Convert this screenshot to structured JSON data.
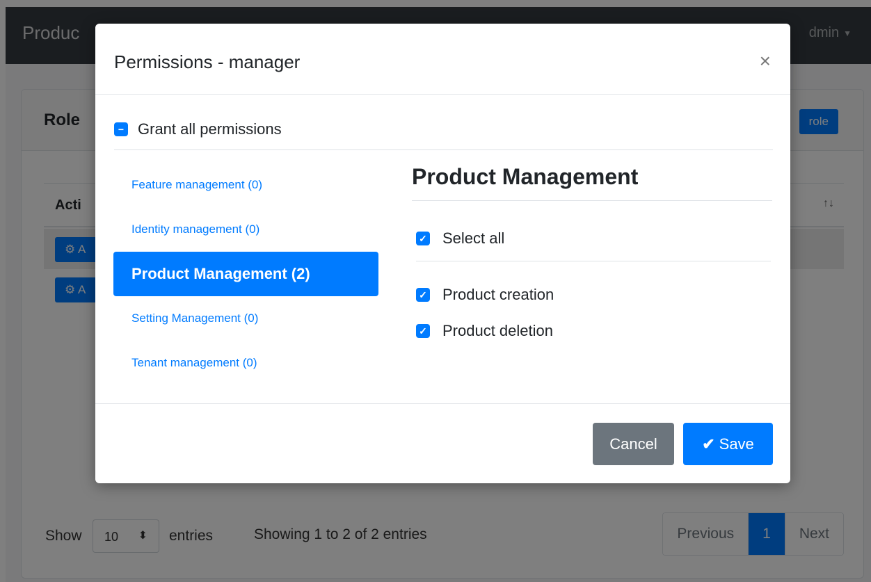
{
  "app": {
    "brand": "Produc",
    "nav_right": "dmin"
  },
  "page": {
    "card_title": "Role",
    "new_role_button": "role",
    "table": {
      "actions_header": "Acti",
      "sort_icon": "↑↓",
      "rows": [
        {
          "action_label": "A"
        },
        {
          "action_label": "A"
        }
      ]
    },
    "footer": {
      "show_label": "Show",
      "page_length": "10",
      "entries_label": "entries",
      "info": "Showing 1 to 2 of 2 entries",
      "previous": "Previous",
      "current_page": "1",
      "next": "Next"
    }
  },
  "modal": {
    "title": "Permissions - manager",
    "close": "×",
    "grant_all_label": "Grant all permissions",
    "grant_all_state": "indeterminate",
    "groups": [
      {
        "label": "Feature management (0)",
        "active": false
      },
      {
        "label": "Identity management (0)",
        "active": false
      },
      {
        "label": "Product Management (2)",
        "active": true
      },
      {
        "label": "Setting Management (0)",
        "active": false
      },
      {
        "label": "Tenant management (0)",
        "active": false
      }
    ],
    "panel": {
      "heading": "Product Management",
      "select_all_label": "Select all",
      "permissions": [
        {
          "label": "Product creation",
          "checked": true
        },
        {
          "label": "Product deletion",
          "checked": true
        }
      ]
    },
    "cancel_label": "Cancel",
    "save_label": "Save"
  },
  "colors": {
    "primary": "#007bff",
    "secondary": "#6c757d",
    "navbar": "#343a40"
  },
  "icons": {
    "gear": "gear-icon",
    "checkmark": "checkmark-icon",
    "minus": "minus-icon",
    "close": "close-icon",
    "sort": "sort-icon",
    "caret": "caret-down-icon"
  }
}
